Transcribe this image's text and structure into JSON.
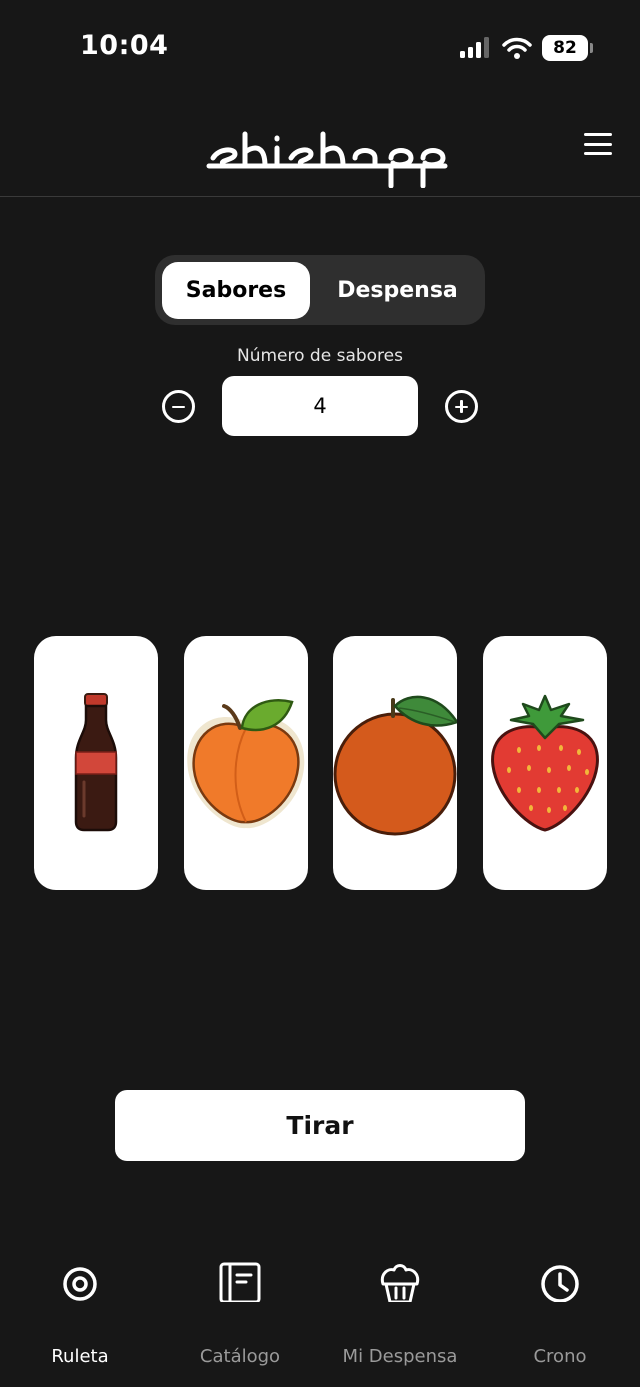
{
  "status": {
    "time": "10:04",
    "battery": "82"
  },
  "header": {
    "logo_text": "shishapp",
    "menu_icon": "hamburger-menu-icon"
  },
  "segmented": {
    "options": [
      "Sabores",
      "Despensa"
    ],
    "selected": "Sabores"
  },
  "counter": {
    "label": "Número de sabores",
    "value": "4",
    "minus_icon": "minus-circle-icon",
    "plus_icon": "plus-circle-icon"
  },
  "reels": [
    {
      "icon": "cola-bottle-icon"
    },
    {
      "icon": "peach-icon"
    },
    {
      "icon": "orange-icon"
    },
    {
      "icon": "strawberry-icon"
    }
  ],
  "action": {
    "label": "Tirar"
  },
  "tabs": [
    {
      "label": "Ruleta",
      "icon": "target-icon",
      "active": true
    },
    {
      "label": "Catálogo",
      "icon": "catalog-book-icon",
      "active": false
    },
    {
      "label": "Mi Despensa",
      "icon": "muffin-icon",
      "active": false
    },
    {
      "label": "Crono",
      "icon": "clock-icon",
      "active": false
    }
  ],
  "colors": {
    "background": "#171717",
    "active_tab": "#ffffff",
    "inactive_tab": "#9a9a9a",
    "segment_track": "#2f2f2f"
  }
}
